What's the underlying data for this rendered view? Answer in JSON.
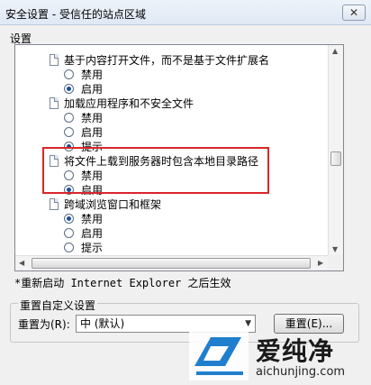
{
  "window": {
    "title": "安全设置 - 受信任的站点区域",
    "close_glyph": "✕"
  },
  "settings": {
    "section_label": "设置",
    "items": [
      {
        "label": "基于内容打开文件，而不是基于文件扩展名"
      },
      {
        "label": "禁用"
      },
      {
        "label": "启用"
      },
      {
        "label": "加载应用程序和不安全文件"
      },
      {
        "label": "禁用"
      },
      {
        "label": "启用"
      },
      {
        "label": "提示"
      },
      {
        "label": "将文件上载到服务器时包含本地目录路径"
      },
      {
        "label": "禁用"
      },
      {
        "label": "启用"
      },
      {
        "label": "跨域浏览窗口和框架"
      },
      {
        "label": "禁用"
      },
      {
        "label": "启用"
      },
      {
        "label": "提示"
      }
    ]
  },
  "note": "*重新启动 Internet Explorer 之后生效",
  "reset": {
    "group_title": "重置自定义设置",
    "label": "重置为(R):",
    "selected": "中 (默认)",
    "button_label": "重置(E)..."
  },
  "watermark": {
    "text": "爱纯净",
    "url": "aichunjing.com"
  },
  "colors": {
    "highlight_border": "#d9262c",
    "radio_checked": "#1a4f9a"
  }
}
